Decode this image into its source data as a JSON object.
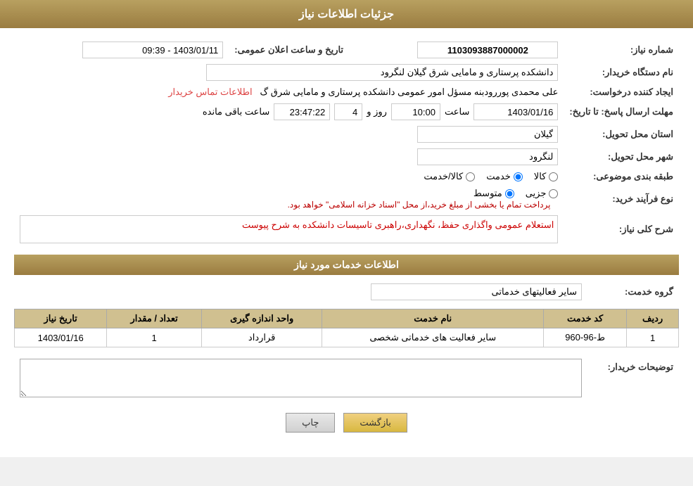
{
  "page": {
    "title": "جزئیات اطلاعات نیاز",
    "sections": {
      "main_info": "جزئیات اطلاعات نیاز",
      "services_info": "اطلاعات خدمات مورد نیاز"
    }
  },
  "fields": {
    "need_number_label": "شماره نیاز:",
    "need_number_value": "1103093887000002",
    "buyer_org_label": "نام دستگاه خریدار:",
    "buyer_org_value": "دانشکده پرستاری و مامایی شرق گیلان لنگرود",
    "creator_label": "ایجاد کننده درخواست:",
    "creator_value": "علی محمدی پوررودبنه مسؤل امور عمومی دانشکده پرستاری و مامایی شرق گ",
    "creator_link": "اطلاعات تماس خریدار",
    "announce_date_label": "تاریخ و ساعت اعلان عمومی:",
    "announce_date_value": "1403/01/11 - 09:39",
    "deadline_label": "مهلت ارسال پاسخ: تا تاریخ:",
    "deadline_date": "1403/01/16",
    "deadline_time": "10:00",
    "deadline_days": "4",
    "deadline_time_remaining": "23:47:22",
    "deadline_remaining_label": "ساعت باقی مانده",
    "deadline_days_label": "روز و",
    "deadline_time_label": "ساعت",
    "province_label": "استان محل تحویل:",
    "province_value": "گیلان",
    "city_label": "شهر محل تحویل:",
    "city_value": "لنگرود",
    "category_label": "طبقه بندی موضوعی:",
    "category_options": [
      "کالا",
      "خدمت",
      "کالا/خدمت"
    ],
    "category_selected": "خدمت",
    "purchase_type_label": "نوع فرآیند خرید:",
    "purchase_type_options": [
      "جزیی",
      "متوسط"
    ],
    "purchase_type_selected": "متوسط",
    "purchase_type_note": "پرداخت تمام یا بخشی از مبلغ خرید،از محل \"اسناد خزانه اسلامی\" خواهد بود.",
    "need_desc_label": "شرح کلی نیاز:",
    "need_desc_value": "استعلام عمومی واگذاری حفظ، نگهداری،راهبری تاسیسات دانشکده به شرح پیوست",
    "service_group_label": "گروه خدمت:",
    "service_group_value": "سایر فعالیتهای خدماتی",
    "buyer_notes_label": "توضیحات خریدار:",
    "buyer_notes_value": ""
  },
  "table": {
    "headers": [
      "ردیف",
      "کد خدمت",
      "نام خدمت",
      "واحد اندازه گیری",
      "تعداد / مقدار",
      "تاریخ نیاز"
    ],
    "rows": [
      {
        "row": "1",
        "service_code": "ط-96-960",
        "service_name": "سایر فعالیت های خدماتی شخصی",
        "unit": "قرارداد",
        "quantity": "1",
        "date": "1403/01/16"
      }
    ]
  },
  "buttons": {
    "print": "چاپ",
    "back": "بازگشت"
  }
}
